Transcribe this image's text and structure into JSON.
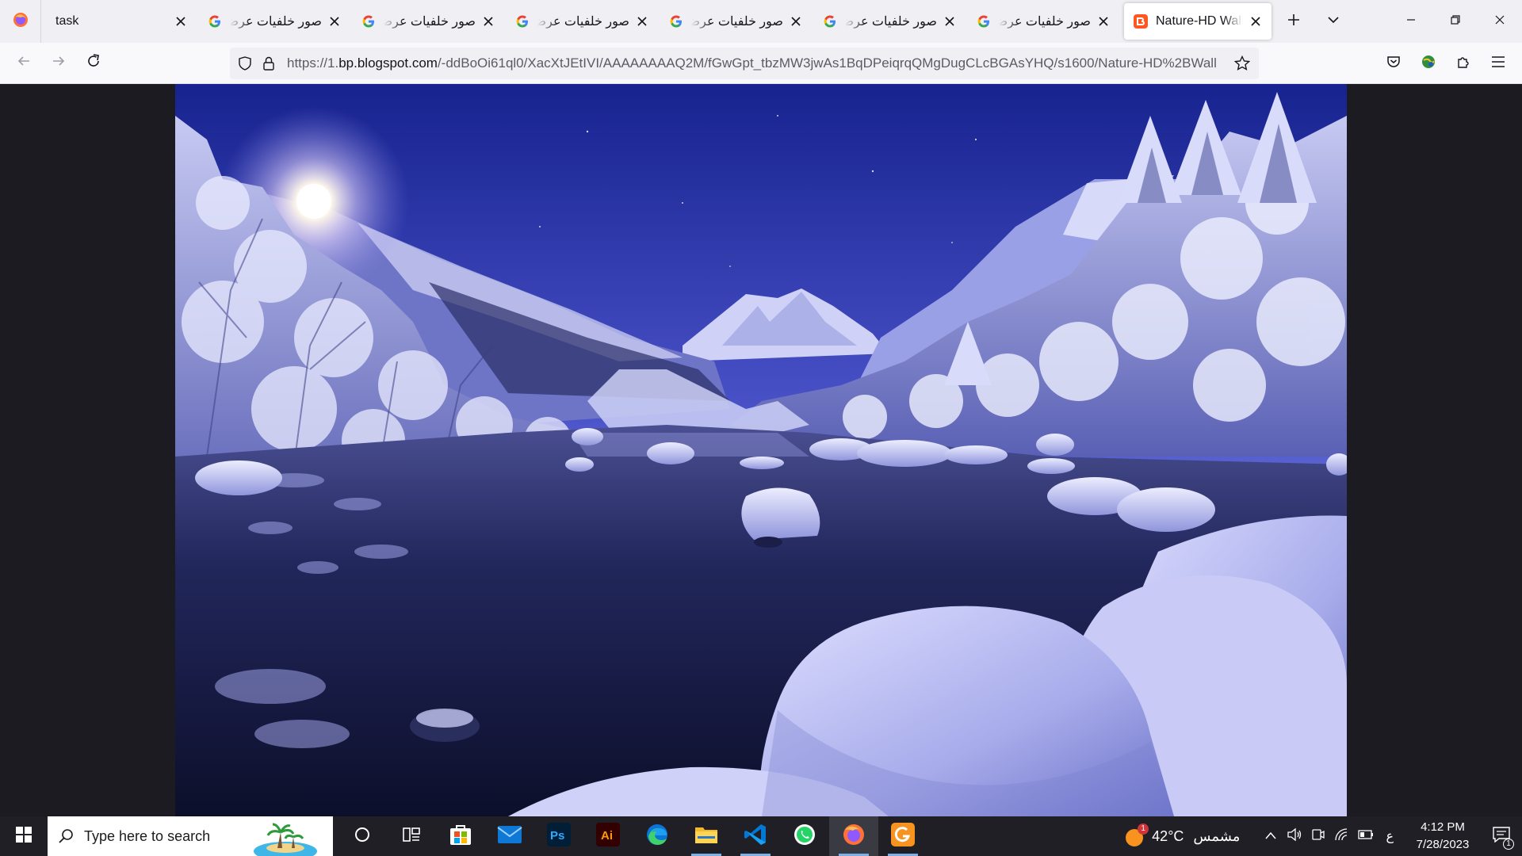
{
  "browser": {
    "tabs": [
      {
        "title": "task",
        "icon": "firefox-icon"
      },
      {
        "title": "صور خلفيات عرض",
        "icon": "google-icon"
      },
      {
        "title": "صور خلفيات عرض",
        "icon": "google-icon"
      },
      {
        "title": "صور خلفيات عرض",
        "icon": "google-icon"
      },
      {
        "title": "صور خلفيات عرض",
        "icon": "google-icon"
      },
      {
        "title": "صور خلفيات عرض",
        "icon": "google-icon"
      },
      {
        "title": "صور خلفيات عرض",
        "icon": "google-icon"
      },
      {
        "title": "Nature-HD Wallp",
        "icon": "blogger-icon",
        "active": true
      }
    ],
    "url_prefix": "https://1.",
    "url_host": "bp.blogspot.com",
    "url_path": "/-ddBoOi61ql0/XacXtJEtIVI/AAAAAAAAQ2M/fGwGpt_tbzMW3jwAs1BqDPeiqrqQMgDugCLcBGAsYHQ/s1600/Nature-HD%2BWall"
  },
  "content": {
    "image_subject": "snowy-river-night-landscape"
  },
  "taskbar": {
    "search_placeholder": "Type here to search",
    "apps": [
      "file-explorer-taskview",
      "microsoft-store",
      "mail",
      "photoshop",
      "illustrator",
      "edge",
      "file-explorer",
      "vscode",
      "whatsapp",
      "firefox",
      "gyazo"
    ],
    "weather_temp": "42°C",
    "weather_text": "مشمس",
    "lang": "ع",
    "time": "4:12 PM",
    "date": "7/28/2023",
    "notification_count": "1",
    "weather_badge": "1"
  },
  "colors": {
    "accent": "#0060df",
    "taskbar": "#1f1f25",
    "sky_top": "#1a2aa8",
    "sky_bottom": "#7a86e6",
    "snow": "#e6e8ff"
  }
}
